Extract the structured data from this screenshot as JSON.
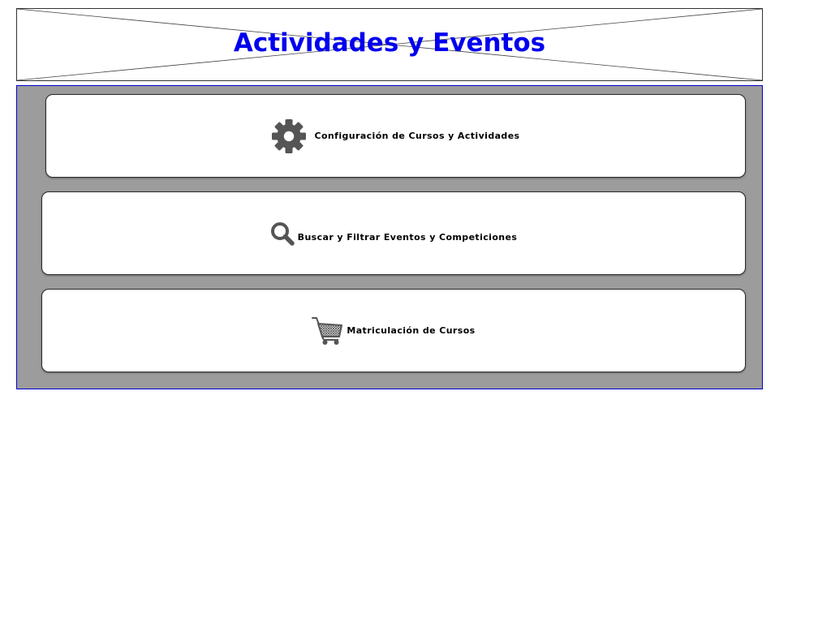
{
  "header": {
    "title": "Actividades y Eventos",
    "title_color": "#0000ee",
    "image_placeholder": true
  },
  "panel": {
    "background": "#9c9c9c",
    "border_color": "#0000cc"
  },
  "menu": [
    {
      "label": "Configuración de Cursos y Actividades",
      "icon": "gear-icon"
    },
    {
      "label": "Buscar y Filtrar Eventos y Competiciones",
      "icon": "search-icon"
    },
    {
      "label": "Matriculación de Cursos",
      "icon": "shopping-cart-icon"
    }
  ],
  "colors": {
    "icon": "#555555",
    "card_background": "#ffffff",
    "card_border": "#2b2b2b"
  }
}
